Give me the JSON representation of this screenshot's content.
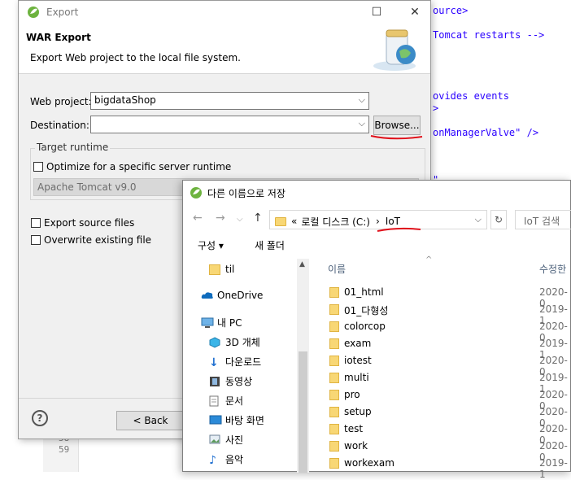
{
  "editor": {
    "code_lines": [
      "ource>",
      "Tomcat restarts -->",
      "ovides events",
      ">",
      "onManagerValve\" />",
      "\""
    ],
    "line_numbers": [
      "58",
      "59"
    ]
  },
  "export_dialog": {
    "title": "Export",
    "banner_title": "WAR Export",
    "banner_desc": "Export Web project to the local file system.",
    "web_project_label": "Web project:",
    "web_project_value": "bigdataShop",
    "destination_label": "Destination:",
    "destination_value": "",
    "browse_label": "Browse...",
    "target_runtime_label": "Target runtime",
    "optimize_label": "Optimize for a specific server runtime",
    "runtime_value": "Apache Tomcat v9.0",
    "export_source_label": "Export source files",
    "overwrite_label": "Overwrite existing file",
    "back_label": "< Back",
    "help_symbol": "?"
  },
  "save_dialog": {
    "title": "다른 이름으로 저장",
    "address": {
      "prefix": "«",
      "crumb1": "로컬 디스크 (C:)",
      "sep": "›",
      "crumb2": "IoT"
    },
    "search_placeholder": "IoT 검색",
    "organize_label": "구성 ▾",
    "new_folder_label": "새 폴더",
    "tree": [
      "til",
      "OneDrive",
      "내 PC",
      "3D 개체",
      "다운로드",
      "동영상",
      "문서",
      "바탕 화면",
      "사진",
      "음악"
    ],
    "columns": {
      "name": "이름",
      "modified": "수정한"
    },
    "files": [
      {
        "name": "01_html",
        "date": "2020-0"
      },
      {
        "name": "01_다형성",
        "date": "2019-1"
      },
      {
        "name": "colorcop",
        "date": "2020-0"
      },
      {
        "name": "exam",
        "date": "2019-1"
      },
      {
        "name": "iotest",
        "date": "2020-0"
      },
      {
        "name": "multi",
        "date": "2019-1"
      },
      {
        "name": "pro",
        "date": "2020-0"
      },
      {
        "name": "setup",
        "date": "2020-0"
      },
      {
        "name": "test",
        "date": "2020-0"
      },
      {
        "name": "work",
        "date": "2020-0"
      },
      {
        "name": "workexam",
        "date": "2019-1"
      }
    ]
  },
  "colors": {
    "annotation": "#e0101a",
    "folder": "#f8d775",
    "accent": "#0063b1"
  }
}
